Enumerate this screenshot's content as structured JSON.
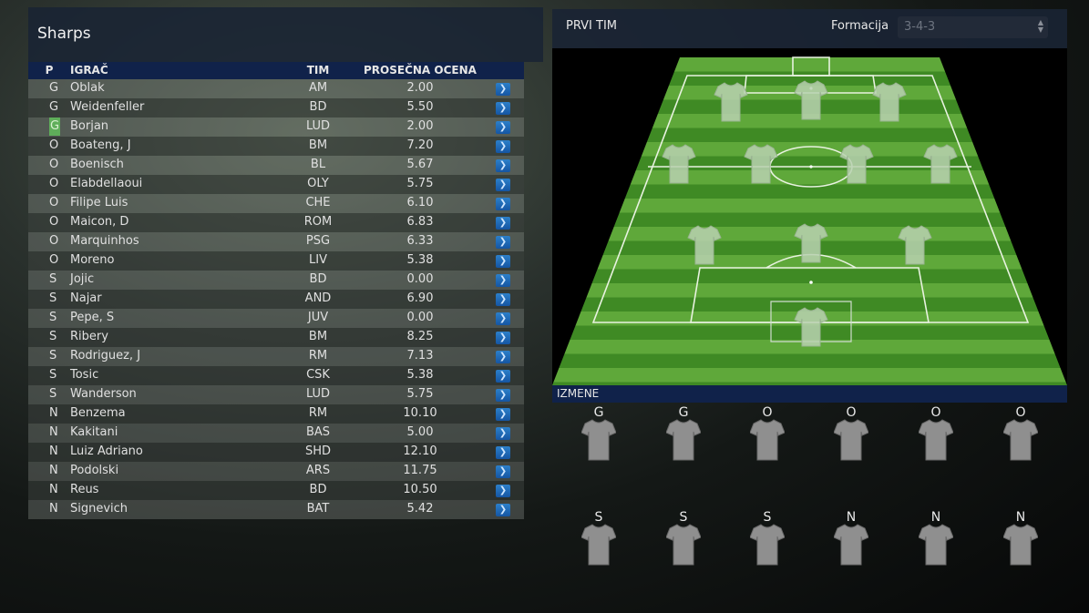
{
  "squad": {
    "title": "Sharps",
    "columns": {
      "pos": "P",
      "player": "IGRAČ",
      "team": "TIM",
      "rating": "PROSEČNA OCENA"
    },
    "players": [
      {
        "pos": "G",
        "name": "Oblak",
        "team": "AM",
        "rating": "2.00"
      },
      {
        "pos": "G",
        "name": "Weidenfeller",
        "team": "BD",
        "rating": "5.50"
      },
      {
        "pos": "G",
        "name": "Borjan",
        "team": "LUD",
        "rating": "2.00"
      },
      {
        "pos": "O",
        "name": "Boateng, J",
        "team": "BM",
        "rating": "7.20"
      },
      {
        "pos": "O",
        "name": "Boenisch",
        "team": "BL",
        "rating": "5.67"
      },
      {
        "pos": "O",
        "name": "Elabdellaoui",
        "team": "OLY",
        "rating": "5.75"
      },
      {
        "pos": "O",
        "name": "Filipe Luis",
        "team": "CHE",
        "rating": "6.10"
      },
      {
        "pos": "O",
        "name": "Maicon, D",
        "team": "ROM",
        "rating": "6.83"
      },
      {
        "pos": "O",
        "name": "Marquinhos",
        "team": "PSG",
        "rating": "6.33"
      },
      {
        "pos": "O",
        "name": "Moreno",
        "team": "LIV",
        "rating": "5.38"
      },
      {
        "pos": "S",
        "name": "Jojic",
        "team": "BD",
        "rating": "0.00"
      },
      {
        "pos": "S",
        "name": "Najar",
        "team": "AND",
        "rating": "6.90"
      },
      {
        "pos": "S",
        "name": "Pepe, S",
        "team": "JUV",
        "rating": "0.00"
      },
      {
        "pos": "S",
        "name": "Ribery",
        "team": "BM",
        "rating": "8.25"
      },
      {
        "pos": "S",
        "name": "Rodriguez, J",
        "team": "RM",
        "rating": "7.13"
      },
      {
        "pos": "S",
        "name": "Tosic",
        "team": "CSK",
        "rating": "5.38"
      },
      {
        "pos": "S",
        "name": "Wanderson",
        "team": "LUD",
        "rating": "5.75"
      },
      {
        "pos": "N",
        "name": "Benzema",
        "team": "RM",
        "rating": "10.10"
      },
      {
        "pos": "N",
        "name": "Kakitani",
        "team": "BAS",
        "rating": "5.00"
      },
      {
        "pos": "N",
        "name": "Luiz Adriano",
        "team": "SHD",
        "rating": "12.10"
      },
      {
        "pos": "N",
        "name": "Podolski",
        "team": "ARS",
        "rating": "11.75"
      },
      {
        "pos": "N",
        "name": "Reus",
        "team": "BD",
        "rating": "10.50"
      },
      {
        "pos": "N",
        "name": "Signevich",
        "team": "BAT",
        "rating": "5.42"
      }
    ],
    "arrow_icon": "chevron-right-icon"
  },
  "team": {
    "label": "PRVI TIM",
    "formation_label": "Formacija",
    "formation_value": "3-4-3"
  },
  "substitutes": {
    "label": "IZMENE",
    "slots": [
      "G",
      "G",
      "O",
      "O",
      "O",
      "O",
      "S",
      "S",
      "S",
      "N",
      "N",
      "N"
    ]
  },
  "colors": {
    "accent": "#1e6bbf",
    "header_bar": "#10224a",
    "panel": "#19233a",
    "pitch_light": "#5fa83a",
    "pitch_dark": "#3f8a24"
  }
}
